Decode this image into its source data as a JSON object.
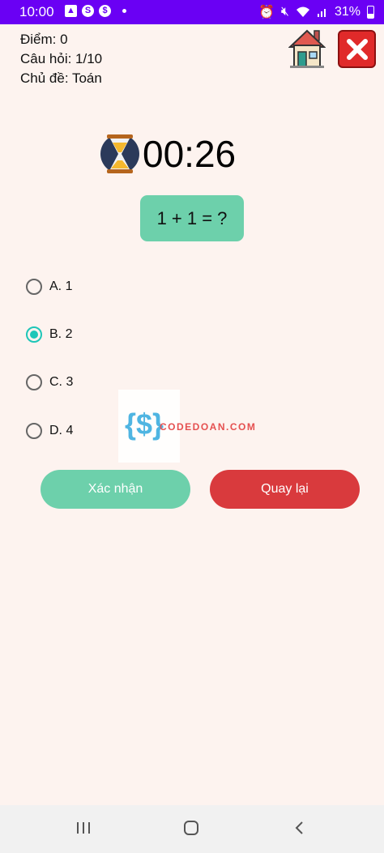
{
  "status_bar": {
    "time": "10:00",
    "battery": "31%",
    "notification_icons": [
      "gallery-icon",
      "s-app-icon",
      "dollar-icon"
    ],
    "system_icons": [
      "alarm-icon",
      "mute-icon",
      "wifi-icon",
      "signal-icon",
      "battery-icon"
    ]
  },
  "info": {
    "score": "Điểm: 0",
    "question_count": "Câu hỏi: 1/10",
    "topic": "Chủ đề: Toán"
  },
  "timer": {
    "value": "00:26"
  },
  "question": {
    "text": "1 + 1 = ?"
  },
  "options": [
    {
      "label": "A. 1",
      "selected": false
    },
    {
      "label": "B. 2",
      "selected": true
    },
    {
      "label": "C. 3",
      "selected": false
    },
    {
      "label": "D. 4",
      "selected": false
    }
  ],
  "watermark": {
    "logo": "{$}",
    "text": "CODEDOAN.COM"
  },
  "buttons": {
    "confirm": "Xác nhận",
    "back": "Quay lại"
  },
  "colors": {
    "status_bar": "#6a00f4",
    "background": "#fdf3ef",
    "accent_green": "#6dd0ab",
    "accent_red": "#d93a3d",
    "radio_selected": "#1ec6b8"
  }
}
